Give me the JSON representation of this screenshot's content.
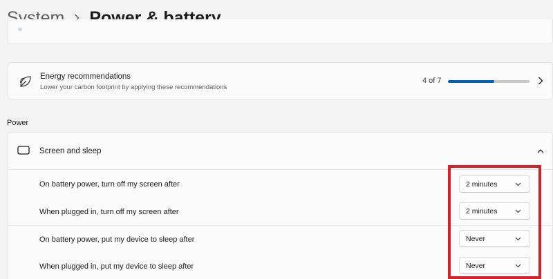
{
  "breadcrumb": {
    "parent": "System",
    "current": "Power & battery"
  },
  "energy_recommendations": {
    "title": "Energy recommendations",
    "subtitle": "Lower your carbon footprint by applying these recommendations",
    "count_label": "4 of 7",
    "progress_fraction": 0.571
  },
  "power_section": {
    "label": "Power",
    "screen_and_sleep": {
      "label": "Screen and sleep",
      "rows": [
        {
          "label": "On battery power, turn off my screen after",
          "value": "2 minutes"
        },
        {
          "label": "When plugged in, turn off my screen after",
          "value": "2 minutes"
        },
        {
          "label": "On battery power, put my device to sleep after",
          "value": "Never"
        },
        {
          "label": "When plugged in, put my device to sleep after",
          "value": "Never"
        }
      ]
    }
  },
  "colors": {
    "accent": "#005fb8",
    "highlight": "#d6202a",
    "background": "#f3f3f3",
    "card": "#fbfbfb"
  },
  "icons": {
    "breadcrumb_separator": "chevron-right-icon",
    "energy": "leaf-icon",
    "energy_nav": "chevron-right-icon",
    "screen_sleep": "monitor-moon-icon",
    "collapse": "chevron-up-icon",
    "dropdown": "chevron-down-icon"
  }
}
